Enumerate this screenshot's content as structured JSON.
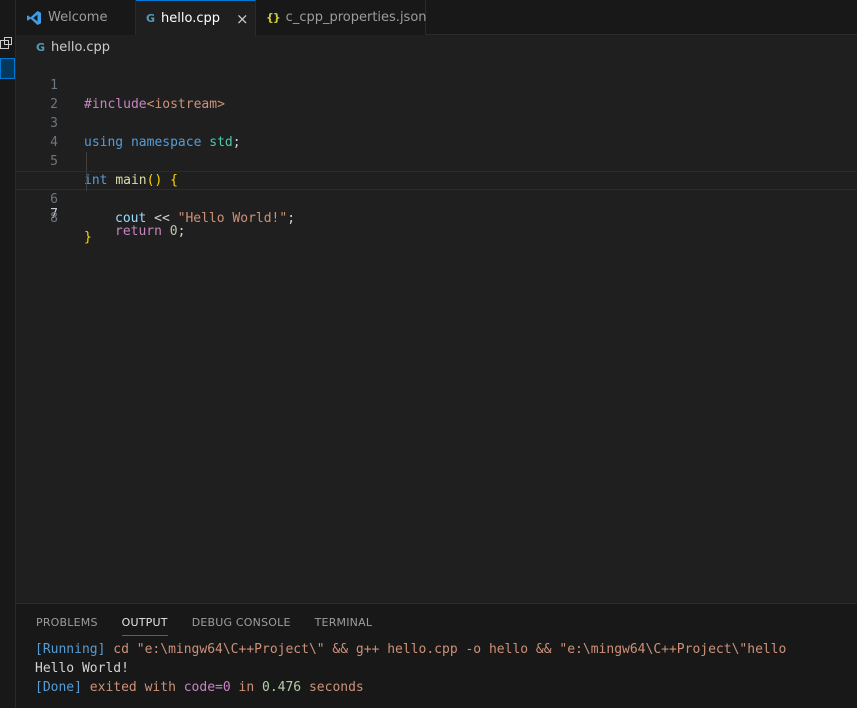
{
  "tabs": [
    {
      "label": "Welcome",
      "icon": "vscode-icon",
      "active": false
    },
    {
      "label": "hello.cpp",
      "icon": "cpp-file-icon",
      "active": true,
      "close": "×"
    },
    {
      "label": "c_cpp_properties.json",
      "icon": "json-file-icon",
      "active": false
    }
  ],
  "breadcrumb": {
    "file": "hello.cpp"
  },
  "icons": {
    "cpp": "G",
    "json": "{}"
  },
  "editor": {
    "current_line": 7,
    "lines": [
      {
        "n": "1",
        "parts": [
          "#include",
          "<iostream>"
        ]
      },
      {
        "n": "2"
      },
      {
        "n": "3",
        "parts": [
          "using",
          "namespace",
          "std",
          ";"
        ]
      },
      {
        "n": "4"
      },
      {
        "n": "5",
        "parts": [
          "int",
          "main",
          "()",
          "{"
        ]
      },
      {
        "n": "6",
        "parts": [
          "cout",
          "<<",
          "\"Hello World!\"",
          ";"
        ]
      },
      {
        "n": "7",
        "parts": [
          "return",
          "0",
          ";"
        ]
      },
      {
        "n": "8",
        "parts": [
          "}"
        ]
      }
    ]
  },
  "panel": {
    "tabs": [
      "PROBLEMS",
      "OUTPUT",
      "DEBUG CONSOLE",
      "TERMINAL"
    ],
    "active_tab": "OUTPUT",
    "output": {
      "running_tag": "[Running]",
      "running_cmd": "cd \"e:\\mingw64\\C++Project\\\" && g++ hello.cpp -o hello && \"e:\\mingw64\\C++Project\\\"hello",
      "program_output": "Hello World!",
      "done_tag": "[Done]",
      "done_exited": "exited with",
      "done_code": "code=0",
      "done_in": "in",
      "done_time": "0.476",
      "done_seconds": "seconds"
    }
  },
  "colors": {
    "accent": "#0078d4",
    "editor_bg": "#1f1f1f",
    "panel_bg": "#181818"
  }
}
